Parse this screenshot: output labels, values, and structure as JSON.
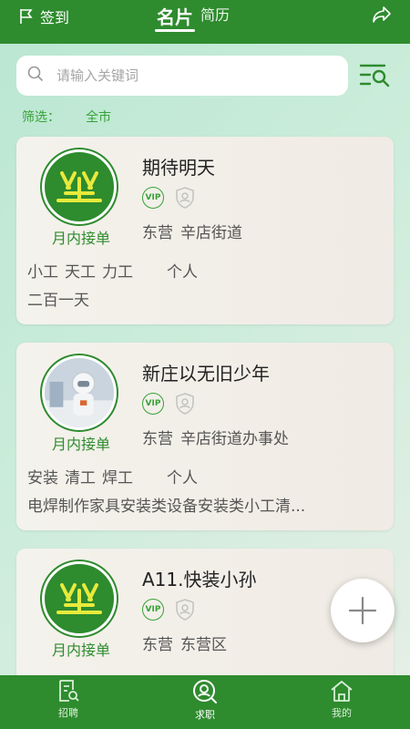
{
  "header": {
    "checkin_label": "签到",
    "tabs": [
      {
        "label": "名片",
        "active": true
      },
      {
        "label": "简历",
        "active": false
      }
    ]
  },
  "search": {
    "placeholder": "请输入关键词"
  },
  "filter": {
    "label": "筛选：",
    "value": "全市"
  },
  "cards": [
    {
      "name": "期待明天",
      "avatar": "logo",
      "monthly_label": "月内接单",
      "badges": [
        "VIP",
        "shield-person-icon"
      ],
      "location": [
        "东营",
        "辛店街道"
      ],
      "skills": [
        "小工",
        "天工",
        "力工"
      ],
      "type": "个人",
      "desc": "二百一天"
    },
    {
      "name": "新庄以无旧少年",
      "avatar": "photo",
      "monthly_label": "月内接单",
      "badges": [
        "VIP",
        "shield-person-icon"
      ],
      "location": [
        "东营",
        "辛店街道办事处"
      ],
      "skills": [
        "安装",
        "清工",
        "焊工"
      ],
      "type": "个人",
      "desc": "电焊制作家具安装类设备安装类小工清..."
    },
    {
      "name": "A11.快装小孙",
      "avatar": "logo",
      "monthly_label": "月内接单",
      "badges": [
        "VIP",
        "shield-person-icon"
      ],
      "location": [
        "东营",
        "东营区"
      ],
      "skills": [],
      "type": "",
      "desc": ""
    }
  ],
  "bottom_nav": [
    {
      "label": "招聘",
      "icon": "document-search-icon",
      "active": false
    },
    {
      "label": "求职",
      "icon": "person-search-icon",
      "active": true
    },
    {
      "label": "我的",
      "icon": "home-icon",
      "active": false
    }
  ],
  "colors": {
    "primary": "#2e8b2e",
    "accent": "#36a236"
  }
}
